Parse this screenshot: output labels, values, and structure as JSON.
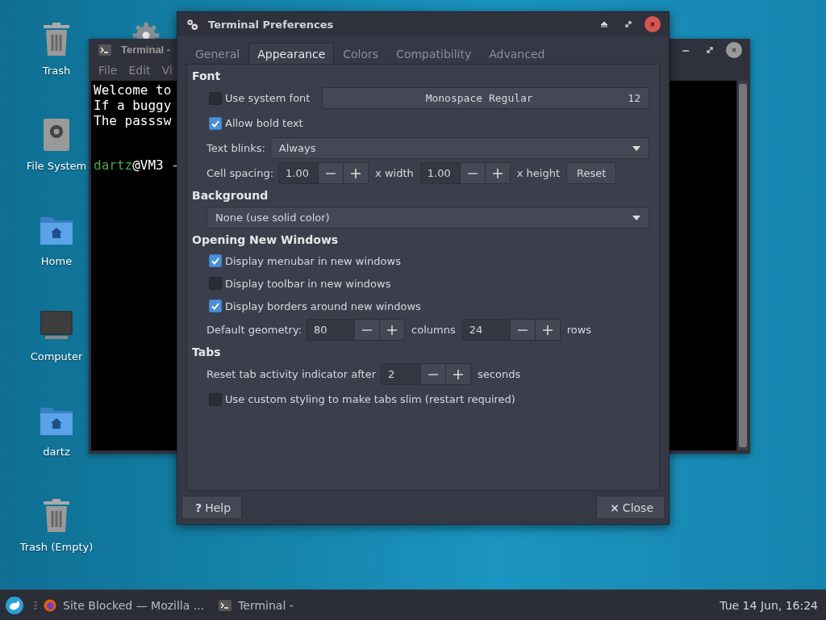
{
  "desktop": {
    "icons": [
      {
        "label": "Trash",
        "kind": "trash"
      },
      {
        "label": "File System",
        "kind": "drive"
      },
      {
        "label": "Home",
        "kind": "home-folder"
      },
      {
        "label": "Computer",
        "kind": "computer"
      },
      {
        "label": "dartz",
        "kind": "home-folder"
      },
      {
        "label": "Trash (Empty)",
        "kind": "trash"
      }
    ]
  },
  "terminal_window": {
    "title": "Terminal -",
    "menu": [
      "File",
      "Edit",
      "Vi"
    ],
    "lines": [
      "Welcome to",
      "If a buggy",
      "The passsw"
    ],
    "prompt": {
      "user": "dartz",
      "host": "@VM3 -"
    }
  },
  "dialog": {
    "title": "Terminal Preferences",
    "tabs": [
      {
        "label": "General",
        "selected": false
      },
      {
        "label": "Appearance",
        "selected": true
      },
      {
        "label": "Colors",
        "selected": false
      },
      {
        "label": "Compatibility",
        "selected": false
      },
      {
        "label": "Advanced",
        "selected": false
      }
    ],
    "font": {
      "heading": "Font",
      "use_system_font": {
        "label": "Use system font",
        "checked": false
      },
      "font_button": {
        "name": "Monospace Regular",
        "size": "12"
      },
      "allow_bold": {
        "label": "Allow bold text",
        "checked": true
      },
      "text_blinks": {
        "label": "Text blinks:",
        "value": "Always"
      },
      "cell_spacing": {
        "label": "Cell spacing:",
        "width_value": "1.00",
        "width_unit": "x width",
        "height_value": "1.00",
        "height_unit": "x height",
        "reset": "Reset"
      }
    },
    "background": {
      "heading": "Background",
      "value": "None (use solid color)"
    },
    "new_windows": {
      "heading": "Opening New Windows",
      "options": [
        {
          "label": "Display menubar in new windows",
          "checked": true
        },
        {
          "label": "Display toolbar in new windows",
          "checked": false
        },
        {
          "label": "Display borders around new windows",
          "checked": true
        }
      ],
      "geometry": {
        "label": "Default geometry:",
        "columns_value": "80",
        "columns_unit": "columns",
        "rows_value": "24",
        "rows_unit": "rows"
      }
    },
    "tabs_section": {
      "heading": "Tabs",
      "reset_activity": {
        "label": "Reset tab activity indicator after",
        "value": "2",
        "unit": "seconds"
      },
      "slim": {
        "label": "Use custom styling to make tabs slim (restart required)",
        "checked": false
      }
    },
    "help_button": {
      "icon": "?",
      "label": "Help"
    },
    "close_button": {
      "icon": "×",
      "label": "Close"
    }
  },
  "taskbar": {
    "items": [
      {
        "label": "Site Blocked — Mozilla ...",
        "kind": "browser"
      },
      {
        "label": "Terminal -",
        "kind": "terminal"
      }
    ],
    "clock": "Tue 14 Jun, 16:24"
  }
}
